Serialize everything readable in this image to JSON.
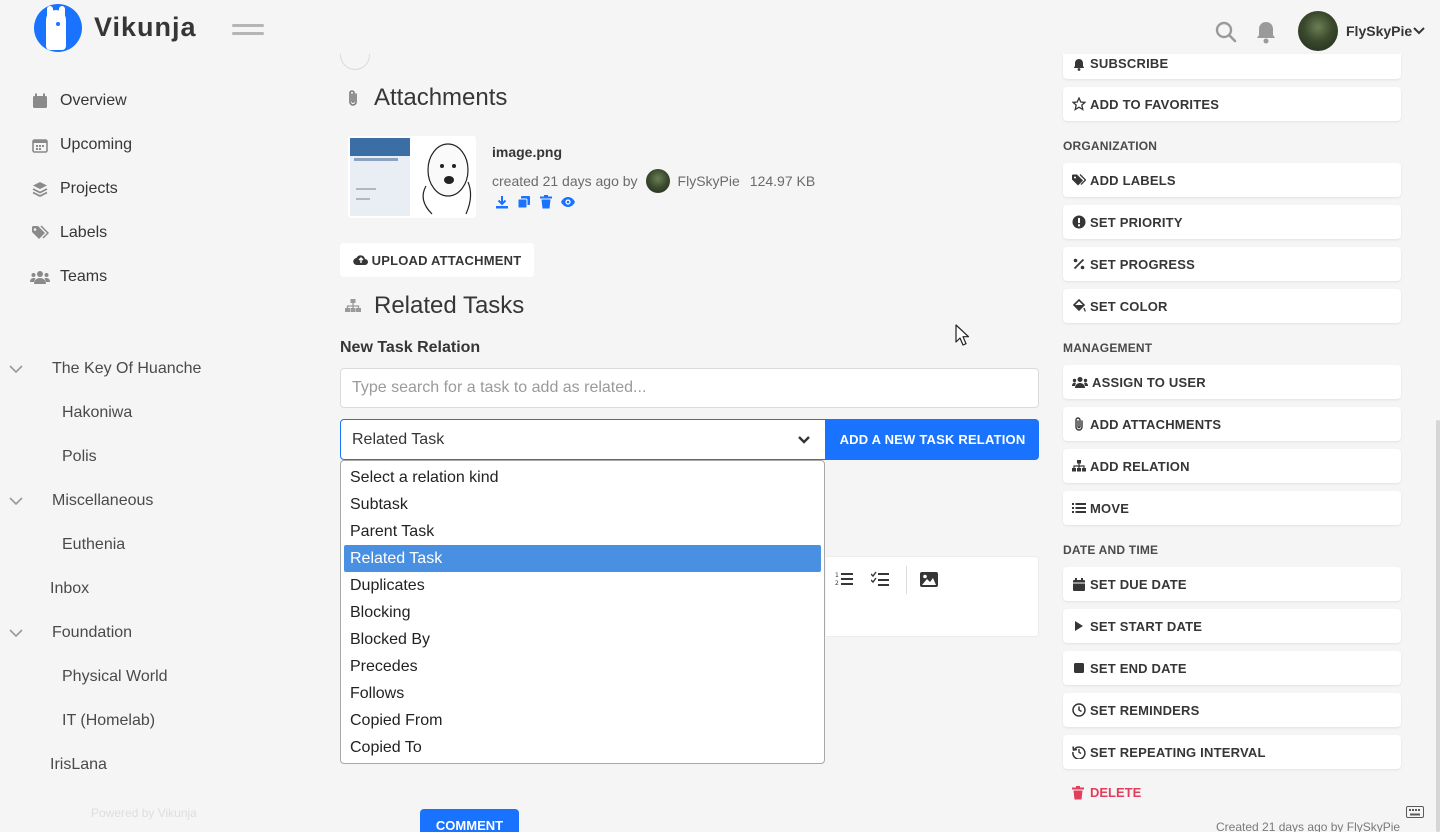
{
  "app": {
    "brand": "Vikunja",
    "username": "FlySkyPie"
  },
  "sidebar": {
    "nav": [
      {
        "label": "Overview",
        "icon": "calendar-icon"
      },
      {
        "label": "Upcoming",
        "icon": "calendar-days-icon"
      },
      {
        "label": "Projects",
        "icon": "layers-icon"
      },
      {
        "label": "Labels",
        "icon": "tags-icon"
      },
      {
        "label": "Teams",
        "icon": "users-icon"
      }
    ],
    "projects": [
      {
        "label": "The Key Of Huanche",
        "expanded": true
      },
      {
        "label": "Hakoniwa"
      },
      {
        "label": "Polis"
      },
      {
        "label": "Miscellaneous",
        "expanded": true
      },
      {
        "label": "Euthenia"
      },
      {
        "label": "Inbox"
      },
      {
        "label": "Foundation",
        "expanded": true
      },
      {
        "label": "Physical World"
      },
      {
        "label": "IT (Homelab)"
      },
      {
        "label": "IrisLana"
      }
    ],
    "powered_by": "Powered by Vikunja"
  },
  "main": {
    "attachments_title": "Attachments",
    "attachment": {
      "name": "image.png",
      "created_prefix": "created 21 days ago by",
      "author": "FlySkyPie",
      "size": "124.97 KB"
    },
    "upload_label": "UPLOAD ATTACHMENT",
    "related_title": "Related Tasks",
    "new_relation_label": "New Task Relation",
    "search_placeholder": "Type search for a task to add as related...",
    "relation_selected": "Related Task",
    "add_relation_button": "ADD A NEW TASK RELATION",
    "relation_options": [
      "Select a relation kind",
      "Subtask",
      "Parent Task",
      "Related Task",
      "Duplicates",
      "Blocking",
      "Blocked By",
      "Precedes",
      "Follows",
      "Copied From",
      "Copied To"
    ],
    "selected_option": "Related Task",
    "comment_button": "COMMENT"
  },
  "right": {
    "top_buttons": [
      {
        "label": "SUBSCRIBE",
        "icon": "bell-icon"
      },
      {
        "label": "ADD TO FAVORITES",
        "icon": "star-icon"
      }
    ],
    "organization_heading": "ORGANIZATION",
    "organization": [
      {
        "label": "ADD LABELS",
        "icon": "tags-icon"
      },
      {
        "label": "SET PRIORITY",
        "icon": "exclamation-circle-icon"
      },
      {
        "label": "SET PROGRESS",
        "icon": "percent-icon"
      },
      {
        "label": "SET COLOR",
        "icon": "paint-bucket-icon"
      }
    ],
    "management_heading": "MANAGEMENT",
    "management": [
      {
        "label": "ASSIGN TO USER",
        "icon": "users-icon"
      },
      {
        "label": "ADD ATTACHMENTS",
        "icon": "paperclip-icon"
      },
      {
        "label": "ADD RELATION",
        "icon": "sitemap-icon"
      },
      {
        "label": "MOVE",
        "icon": "list-icon"
      }
    ],
    "datetime_heading": "DATE AND TIME",
    "datetime": [
      {
        "label": "SET DUE DATE",
        "icon": "calendar-icon"
      },
      {
        "label": "SET START DATE",
        "icon": "play-icon"
      },
      {
        "label": "SET END DATE",
        "icon": "stop-icon"
      },
      {
        "label": "SET REMINDERS",
        "icon": "clock-icon"
      },
      {
        "label": "SET REPEATING INTERVAL",
        "icon": "history-icon"
      }
    ],
    "delete_label": "DELETE",
    "created_note": "Created 21 days ago by FlySkyPie"
  },
  "colors": {
    "primary": "#1973ff",
    "danger": "#e23e5b",
    "selected_option": "#4a90e2"
  }
}
